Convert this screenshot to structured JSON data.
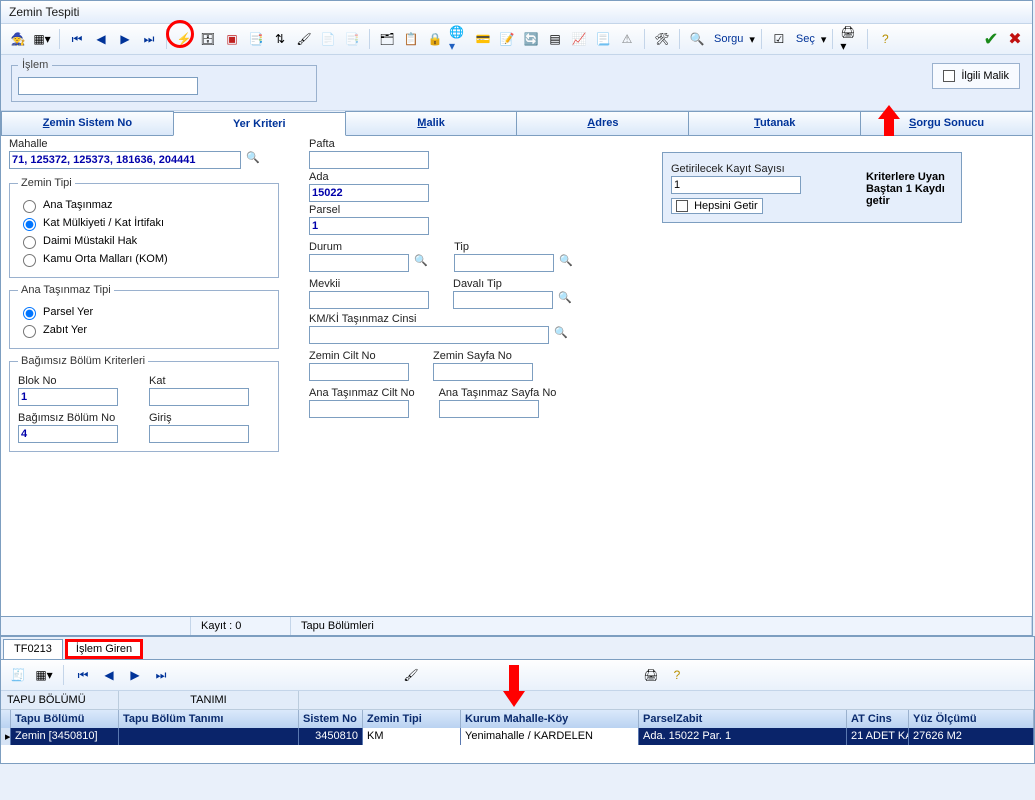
{
  "window_title": "Zemin Tespiti",
  "toolbar_labels": {
    "sorgu": "Sorgu",
    "sec": "Seç"
  },
  "islem": {
    "legend": "İşlem",
    "value": ""
  },
  "ilgili_malik": "İlgili Malik",
  "tabs": {
    "zemin_sistem_no": "Zemin Sistem No",
    "yer_kriteri": "Yer Kriteri",
    "malik": "Malik",
    "adres": "Adres",
    "tutanak": "Tutanak",
    "sorgu_sonucu": "Sorgu Sonucu"
  },
  "labels": {
    "mahalle": "Mahalle",
    "mahalle_val": "71, 125372, 125373, 181636, 204441",
    "zemin_tipi": "Zemin Tipi",
    "ana_tasinmaz": "Ana Taşınmaz",
    "kat_mulkiyeti": "Kat Mülkiyeti / Kat İrtifakı",
    "daimi_mustakil": "Daimi Müstakil Hak",
    "kamu_orta": "Kamu Orta Malları (KOM)",
    "ana_tasinmaz_tipi": "Ana Taşınmaz Tipi",
    "parsel_yer": "Parsel Yer",
    "zabit_yer": "Zabıt Yer",
    "bagimsiz_bolum_kriterleri": "Bağımsız Bölüm Kriterleri",
    "blok_no": "Blok No",
    "blok_no_val": "1",
    "kat": "Kat",
    "kat_val": "",
    "bagimsiz_bolum_no": "Bağımsız Bölüm No",
    "bb_no_val": "4",
    "giris": "Giriş",
    "giris_val": "",
    "pafta": "Pafta",
    "pafta_val": "",
    "ada": "Ada",
    "ada_val": "15022",
    "parsel": "Parsel",
    "parsel_val": "1",
    "durum": "Durum",
    "durum_val": "",
    "tip": "Tip",
    "tip_val": "",
    "mevkii": "Mevkii",
    "mevkii_val": "",
    "davali_tip": "Davalı Tip",
    "davali_val": "",
    "kmki": "KM/Kİ Taşınmaz Cinsi",
    "kmki_val": "",
    "zemin_cilt": "Zemin Cilt No",
    "zemin_cilt_val": "",
    "zemin_sayfa": "Zemin Sayfa No",
    "zemin_sayfa_val": "",
    "at_cilt": "Ana Taşınmaz Cilt No",
    "at_cilt_val": "",
    "at_sayfa": "Ana Taşınmaz Sayfa No",
    "at_sayfa_val": ""
  },
  "fetch": {
    "getirilecek": "Getirilecek Kayıt Sayısı",
    "value": "1",
    "hepsini": "Hepsini Getir",
    "line1": "Kriterlere Uyan",
    "line2": "Baştan 1 Kaydı getir"
  },
  "status": {
    "kayit": "Kayıt : 0",
    "tapu": "Tapu Bölümleri"
  },
  "lower": {
    "tab1": "TF0213",
    "tab2": "İşlem Giren",
    "hdr_top1": "TAPU BÖLÜMÜ",
    "hdr_top2": "TANIMI",
    "cols": {
      "tapu_bolumu": "Tapu Bölümü",
      "tapu_tanim": "Tapu Bölüm Tanımı",
      "sistem_no": "Sistem No",
      "zemin_tipi": "Zemin Tipi",
      "kurum": "Kurum Mahalle-Köy",
      "parsel_zabit": "ParselZabit",
      "at_cins": "AT Cins",
      "yuz": "Yüz Ölçümü"
    },
    "row": {
      "tapu_bolumu": "Zemin [3450810]",
      "tapu_tanim": "",
      "sistem_no": "3450810",
      "zemin_tipi": "KM",
      "kurum": "Yenimahalle / KARDELEN",
      "parsel_zabit": "Ada. 15022 Par. 1",
      "at_cins": "21 ADET KA",
      "yuz": "27626 M2"
    }
  }
}
